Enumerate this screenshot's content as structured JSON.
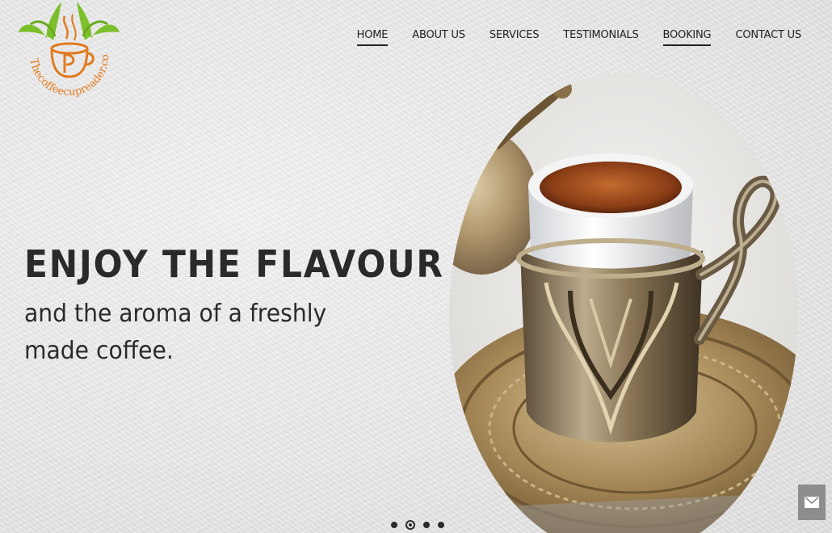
{
  "logo": {
    "text": "Thecoffeecupreader.com",
    "accent_green": "#7bbf2a",
    "accent_orange": "#e07a1e"
  },
  "nav": {
    "items": [
      {
        "label": "HOME",
        "active": true
      },
      {
        "label": "ABOUT US",
        "active": false
      },
      {
        "label": "SERVICES",
        "active": false
      },
      {
        "label": "TESTIMONIALS",
        "active": false
      },
      {
        "label": "BOOKING",
        "active": true
      },
      {
        "label": "CONTACT US",
        "active": false
      }
    ]
  },
  "hero": {
    "title": "ENJOY THE FLAVOUR",
    "subtitle": "and the aroma of a freshly made coffee."
  },
  "slider": {
    "count": 4,
    "active_index": 1
  },
  "contact_button": {
    "icon": "envelope-icon"
  }
}
